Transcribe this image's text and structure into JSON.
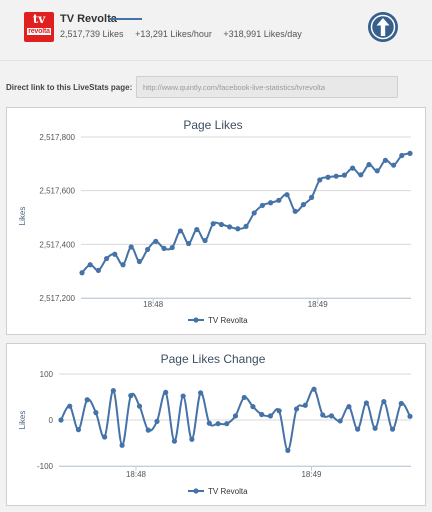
{
  "header": {
    "logo": {
      "line1": "tv",
      "line2": "revolta"
    },
    "page_name": "TV Revolta",
    "likes": "2,517,739 Likes",
    "likes_per_hour": "+13,291 Likes/hour",
    "likes_per_day": "+318,991 Likes/day",
    "series_color": "#4572a7",
    "nav_icon": "upload-arrow-icon"
  },
  "link": {
    "label": "Direct link to this LiveStats page:",
    "url": "http://www.quintly.com/facebook-live-statistics/tvrevolta"
  },
  "chart_data": [
    {
      "type": "line",
      "title": "Page Likes",
      "ylabel": "Likes",
      "xlabel": "",
      "ylim": [
        2517200,
        2517800
      ],
      "yticks": [
        2517200,
        2517400,
        2517600,
        2517800
      ],
      "ytick_labels": [
        "2,517,200",
        "2,517,400",
        "2,517,600",
        "2,517,800"
      ],
      "xticks": [
        {
          "label": "18:48",
          "pos": 0.2187
        },
        {
          "label": "18:49",
          "pos": 0.7173
        }
      ],
      "grid": true,
      "legend": "bottom-center",
      "color": "#4572a7",
      "series": [
        {
          "name": "TV Revolta",
          "values": [
            2517294,
            2517324,
            2517303,
            2517347,
            2517363,
            2517324,
            2517390,
            2517336,
            2517381,
            2517411,
            2517385,
            2517388,
            2517450,
            2517403,
            2517455,
            2517414,
            2517477,
            2517474,
            2517465,
            2517458,
            2517467,
            2517517,
            2517545,
            2517555,
            2517564,
            2517585,
            2517523,
            2517548,
            2517575,
            2517640,
            2517650,
            2517654,
            2517658,
            2517684,
            2517659,
            2517697,
            2517674,
            2517713,
            2517695,
            2517731,
            2517739
          ]
        }
      ]
    },
    {
      "type": "line",
      "title": "Page Likes Change",
      "ylabel": "Likes",
      "xlabel": "",
      "ylim": [
        -100,
        100
      ],
      "yticks": [
        -100,
        0,
        100
      ],
      "ytick_labels": [
        "-100",
        "0",
        "100"
      ],
      "xticks": [
        {
          "label": "18:48",
          "pos": 0.2187
        },
        {
          "label": "18:49",
          "pos": 0.7173
        }
      ],
      "grid": true,
      "legend": "bottom-center",
      "color": "#4572a7",
      "series": [
        {
          "name": "TV Revolta",
          "values": [
            0,
            30,
            -21,
            44,
            16,
            -37,
            64,
            -55,
            53,
            30,
            -22,
            -3,
            60,
            -46,
            52,
            -42,
            59,
            -7,
            -8,
            -8,
            9,
            49,
            29,
            12,
            9,
            20,
            -66,
            24,
            32,
            67,
            11,
            9,
            -2,
            29,
            -20,
            37,
            -18,
            40,
            -20,
            36,
            8
          ]
        }
      ]
    }
  ]
}
